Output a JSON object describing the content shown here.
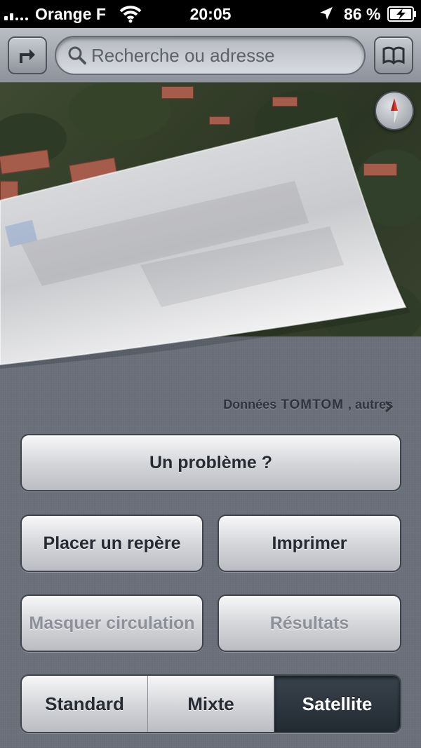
{
  "status_bar": {
    "carrier": "Orange F",
    "time": "20:05",
    "battery_percent": "86 %",
    "icons": [
      "signal-icon",
      "wifi-icon",
      "location-arrow-icon",
      "battery-charging-icon"
    ]
  },
  "nav_bar": {
    "search_placeholder": "Recherche ou adresse",
    "icons": [
      "directions-icon",
      "search-icon",
      "bookmarks-icon"
    ]
  },
  "map": {
    "icons": [
      "compass-icon"
    ]
  },
  "panel": {
    "attribution": {
      "prefix": "Données",
      "brand": "TOMTOM",
      "suffix": ", autres"
    },
    "buttons": {
      "report_problem": "Un problème ?",
      "drop_pin": "Placer un repère",
      "print": "Imprimer",
      "hide_traffic": "Masquer circulation",
      "results": "Résultats"
    },
    "map_type": {
      "options": [
        "Standard",
        "Mixte",
        "Satellite"
      ],
      "selected": "Satellite"
    }
  },
  "colors": {
    "panel_background": "#6b707b",
    "selected_segment": "#2a323b",
    "button_text": "#262a33",
    "disabled_text": "#8d9098"
  }
}
